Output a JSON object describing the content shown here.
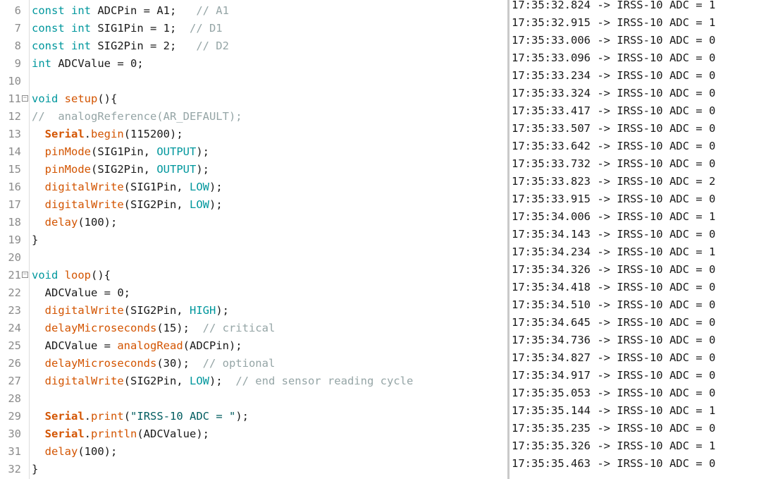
{
  "editor": {
    "lines": [
      {
        "n": "6",
        "fold": false,
        "tokens": [
          {
            "t": "const int",
            "c": "kw"
          },
          {
            "t": " ADCPin = A1;   "
          },
          {
            "t": "// A1",
            "c": "cm"
          }
        ]
      },
      {
        "n": "7",
        "fold": false,
        "tokens": [
          {
            "t": "const int",
            "c": "kw"
          },
          {
            "t": " SIG1Pin = 1;  "
          },
          {
            "t": "// D1",
            "c": "cm"
          }
        ]
      },
      {
        "n": "8",
        "fold": false,
        "tokens": [
          {
            "t": "const int",
            "c": "kw"
          },
          {
            "t": " SIG2Pin = 2;   "
          },
          {
            "t": "// D2",
            "c": "cm"
          }
        ]
      },
      {
        "n": "9",
        "fold": false,
        "tokens": [
          {
            "t": "int",
            "c": "kw"
          },
          {
            "t": " ADCValue = 0;"
          }
        ]
      },
      {
        "n": "10",
        "fold": false,
        "tokens": []
      },
      {
        "n": "11",
        "fold": true,
        "tokens": [
          {
            "t": "void",
            "c": "kw"
          },
          {
            "t": " "
          },
          {
            "t": "setup",
            "c": "fn"
          },
          {
            "t": "(){"
          }
        ]
      },
      {
        "n": "12",
        "fold": false,
        "tokens": [
          {
            "t": "//  analogReference(AR_DEFAULT);",
            "c": "cm"
          }
        ]
      },
      {
        "n": "13",
        "fold": false,
        "tokens": [
          {
            "t": "  "
          },
          {
            "t": "Serial",
            "c": "ser"
          },
          {
            "t": "."
          },
          {
            "t": "begin",
            "c": "fn"
          },
          {
            "t": "(115200);"
          }
        ]
      },
      {
        "n": "14",
        "fold": false,
        "tokens": [
          {
            "t": "  "
          },
          {
            "t": "pinMode",
            "c": "fn"
          },
          {
            "t": "(SIG1Pin, "
          },
          {
            "t": "OUTPUT",
            "c": "cst"
          },
          {
            "t": ");"
          }
        ]
      },
      {
        "n": "15",
        "fold": false,
        "tokens": [
          {
            "t": "  "
          },
          {
            "t": "pinMode",
            "c": "fn"
          },
          {
            "t": "(SIG2Pin, "
          },
          {
            "t": "OUTPUT",
            "c": "cst"
          },
          {
            "t": ");"
          }
        ]
      },
      {
        "n": "16",
        "fold": false,
        "tokens": [
          {
            "t": "  "
          },
          {
            "t": "digitalWrite",
            "c": "fn"
          },
          {
            "t": "(SIG1Pin, "
          },
          {
            "t": "LOW",
            "c": "cst"
          },
          {
            "t": ");"
          }
        ]
      },
      {
        "n": "17",
        "fold": false,
        "tokens": [
          {
            "t": "  "
          },
          {
            "t": "digitalWrite",
            "c": "fn"
          },
          {
            "t": "(SIG2Pin, "
          },
          {
            "t": "LOW",
            "c": "cst"
          },
          {
            "t": ");"
          }
        ]
      },
      {
        "n": "18",
        "fold": false,
        "tokens": [
          {
            "t": "  "
          },
          {
            "t": "delay",
            "c": "fn"
          },
          {
            "t": "(100);"
          }
        ]
      },
      {
        "n": "19",
        "fold": false,
        "tokens": [
          {
            "t": "}"
          }
        ]
      },
      {
        "n": "20",
        "fold": false,
        "tokens": []
      },
      {
        "n": "21",
        "fold": true,
        "tokens": [
          {
            "t": "void",
            "c": "kw"
          },
          {
            "t": " "
          },
          {
            "t": "loop",
            "c": "fn"
          },
          {
            "t": "(){"
          }
        ]
      },
      {
        "n": "22",
        "fold": false,
        "tokens": [
          {
            "t": "  ADCValue = 0;"
          }
        ]
      },
      {
        "n": "23",
        "fold": false,
        "tokens": [
          {
            "t": "  "
          },
          {
            "t": "digitalWrite",
            "c": "fn"
          },
          {
            "t": "(SIG2Pin, "
          },
          {
            "t": "HIGH",
            "c": "cst"
          },
          {
            "t": ");"
          }
        ]
      },
      {
        "n": "24",
        "fold": false,
        "tokens": [
          {
            "t": "  "
          },
          {
            "t": "delayMicroseconds",
            "c": "fn"
          },
          {
            "t": "(15);  "
          },
          {
            "t": "// critical",
            "c": "cm"
          }
        ]
      },
      {
        "n": "25",
        "fold": false,
        "tokens": [
          {
            "t": "  ADCValue = "
          },
          {
            "t": "analogRead",
            "c": "fn"
          },
          {
            "t": "(ADCPin);"
          }
        ]
      },
      {
        "n": "26",
        "fold": false,
        "tokens": [
          {
            "t": "  "
          },
          {
            "t": "delayMicroseconds",
            "c": "fn"
          },
          {
            "t": "(30);  "
          },
          {
            "t": "// optional",
            "c": "cm"
          }
        ]
      },
      {
        "n": "27",
        "fold": false,
        "tokens": [
          {
            "t": "  "
          },
          {
            "t": "digitalWrite",
            "c": "fn"
          },
          {
            "t": "(SIG2Pin, "
          },
          {
            "t": "LOW",
            "c": "cst"
          },
          {
            "t": ");  "
          },
          {
            "t": "// end sensor reading cycle",
            "c": "cm"
          }
        ]
      },
      {
        "n": "28",
        "fold": false,
        "tokens": []
      },
      {
        "n": "29",
        "fold": false,
        "tokens": [
          {
            "t": "  "
          },
          {
            "t": "Serial",
            "c": "ser"
          },
          {
            "t": "."
          },
          {
            "t": "print",
            "c": "fn"
          },
          {
            "t": "("
          },
          {
            "t": "\"IRSS-10 ADC = \"",
            "c": "str"
          },
          {
            "t": ");"
          }
        ]
      },
      {
        "n": "30",
        "fold": false,
        "tokens": [
          {
            "t": "  "
          },
          {
            "t": "Serial",
            "c": "ser"
          },
          {
            "t": "."
          },
          {
            "t": "println",
            "c": "fn"
          },
          {
            "t": "(ADCValue);"
          }
        ]
      },
      {
        "n": "31",
        "fold": false,
        "tokens": [
          {
            "t": "  "
          },
          {
            "t": "delay",
            "c": "fn"
          },
          {
            "t": "(100);"
          }
        ]
      },
      {
        "n": "32",
        "fold": false,
        "tokens": [
          {
            "t": "}"
          }
        ]
      }
    ]
  },
  "monitor": {
    "rows": [
      "17:35:32.824 -> IRSS-10 ADC = 1",
      "17:35:32.915 -> IRSS-10 ADC = 1",
      "17:35:33.006 -> IRSS-10 ADC = 0",
      "17:35:33.096 -> IRSS-10 ADC = 0",
      "17:35:33.234 -> IRSS-10 ADC = 0",
      "17:35:33.324 -> IRSS-10 ADC = 0",
      "17:35:33.417 -> IRSS-10 ADC = 0",
      "17:35:33.507 -> IRSS-10 ADC = 0",
      "17:35:33.642 -> IRSS-10 ADC = 0",
      "17:35:33.732 -> IRSS-10 ADC = 0",
      "17:35:33.823 -> IRSS-10 ADC = 2",
      "17:35:33.915 -> IRSS-10 ADC = 0",
      "17:35:34.006 -> IRSS-10 ADC = 1",
      "17:35:34.143 -> IRSS-10 ADC = 0",
      "17:35:34.234 -> IRSS-10 ADC = 1",
      "17:35:34.326 -> IRSS-10 ADC = 0",
      "17:35:34.418 -> IRSS-10 ADC = 0",
      "17:35:34.510 -> IRSS-10 ADC = 0",
      "17:35:34.645 -> IRSS-10 ADC = 0",
      "17:35:34.736 -> IRSS-10 ADC = 0",
      "17:35:34.827 -> IRSS-10 ADC = 0",
      "17:35:34.917 -> IRSS-10 ADC = 0",
      "17:35:35.053 -> IRSS-10 ADC = 0",
      "17:35:35.144 -> IRSS-10 ADC = 1",
      "17:35:35.235 -> IRSS-10 ADC = 0",
      "17:35:35.326 -> IRSS-10 ADC = 1",
      "17:35:35.463 -> IRSS-10 ADC = 0"
    ]
  }
}
